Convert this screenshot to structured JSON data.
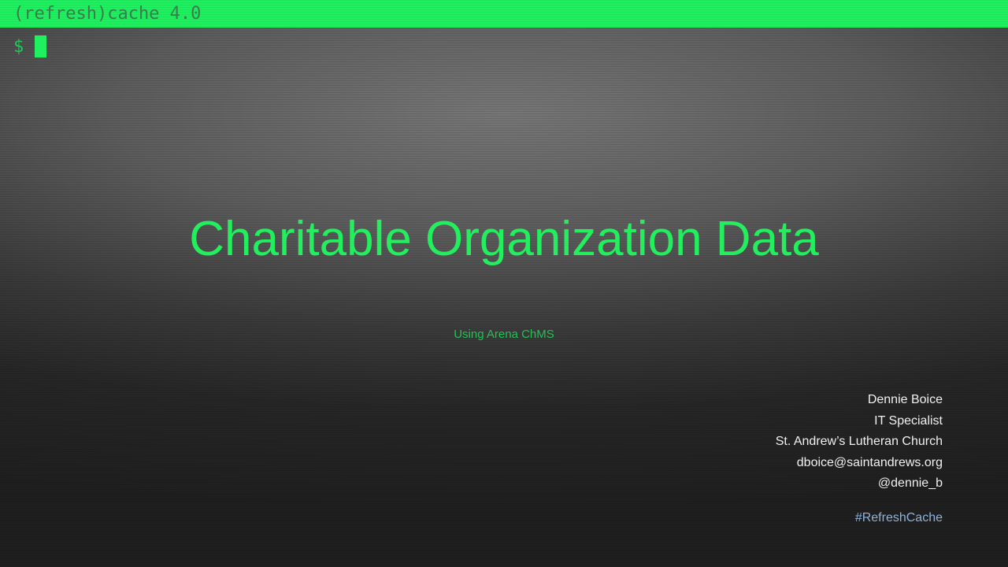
{
  "terminal": {
    "title": "(refresh)cache 4.0",
    "prompt_symbol": "$"
  },
  "slide": {
    "title": "Charitable Organization Data",
    "subtitle": "Using Arena ChMS",
    "presenter": {
      "name": "Dennie Boice",
      "role": "IT Specialist",
      "organization": "St. Andrew’s Lutheran Church",
      "email": "dboice@saintandrews.org",
      "handle": "@dennie_b"
    },
    "hashtag": "#RefreshCache"
  },
  "colors": {
    "accent_green": "#1ff060",
    "title_green": "#22ee5e",
    "hashtag_blue": "#8fb2dd",
    "background_dark": "#1f1f1f"
  }
}
